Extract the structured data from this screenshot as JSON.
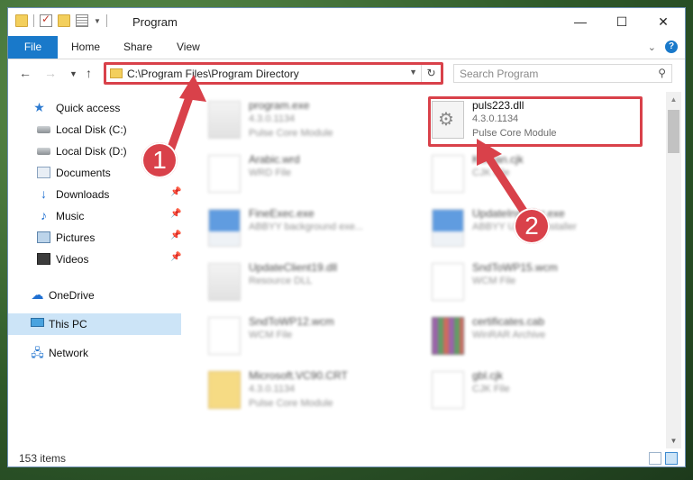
{
  "window": {
    "title": "Program",
    "minimize_glyph": "—",
    "maximize_glyph": "☐",
    "close_glyph": "✕"
  },
  "ribbon": {
    "tabs": [
      "File",
      "Home",
      "Share",
      "View"
    ],
    "help_glyph": "?"
  },
  "address": {
    "path": "C:\\Program Files\\Program Directory",
    "search_placeholder": "Search Program"
  },
  "nav": [
    {
      "label": "Quick access",
      "icon": "star-icon"
    },
    {
      "label": "Local Disk (C:)",
      "icon": "disk-icon"
    },
    {
      "label": "Local Disk (D:)",
      "icon": "disk-icon"
    },
    {
      "label": "Documents",
      "icon": "documents-icon"
    },
    {
      "label": "Downloads",
      "icon": "download-icon"
    },
    {
      "label": "Music",
      "icon": "music-icon"
    },
    {
      "label": "Pictures",
      "icon": "pictures-icon"
    },
    {
      "label": "Videos",
      "icon": "videos-icon"
    },
    {
      "label": "OneDrive",
      "icon": "cloud-icon"
    },
    {
      "label": "This PC",
      "icon": "computer-icon"
    },
    {
      "label": "Network",
      "icon": "network-icon"
    }
  ],
  "files": [
    {
      "name": "program.exe",
      "line1": "4.3.0.1134",
      "line2": "Pulse Core Module"
    },
    {
      "name": "puls223.dll",
      "line1": "4.3.0.1134",
      "line2": "Pulse Core Module"
    },
    {
      "name": "Arabic.wrd",
      "line1": "WRD File",
      "line2": ""
    },
    {
      "name": "Korean.cjk",
      "line1": "CJK File",
      "line2": ""
    },
    {
      "name": "FineExec.exe",
      "line1": "ABBYY background exe...",
      "line2": ""
    },
    {
      "name": "UpdateInstaller.exe",
      "line1": "ABBYY Update installer",
      "line2": ""
    },
    {
      "name": "UpdateClient19.dll",
      "line1": "Resource DLL",
      "line2": ""
    },
    {
      "name": "SndToWP15.wcm",
      "line1": "WCM File",
      "line2": ""
    },
    {
      "name": "SndToWP12.wcm",
      "line1": "WCM File",
      "line2": ""
    },
    {
      "name": "certificates.cab",
      "line1": "WinRAR Archive",
      "line2": ""
    },
    {
      "name": "Microsoft.VC90.CRT",
      "line1": "4.3.0.1134",
      "line2": "Pulse Core Module"
    },
    {
      "name": "gbl.cjk",
      "line1": "CJK File",
      "line2": ""
    }
  ],
  "status": {
    "item_count": "153 items"
  },
  "annotations": {
    "callout_1": "1",
    "callout_2": "2",
    "highlight_color": "#d9414a"
  },
  "colors": {
    "accent": "#1979ca",
    "selected": "#cce4f7"
  }
}
